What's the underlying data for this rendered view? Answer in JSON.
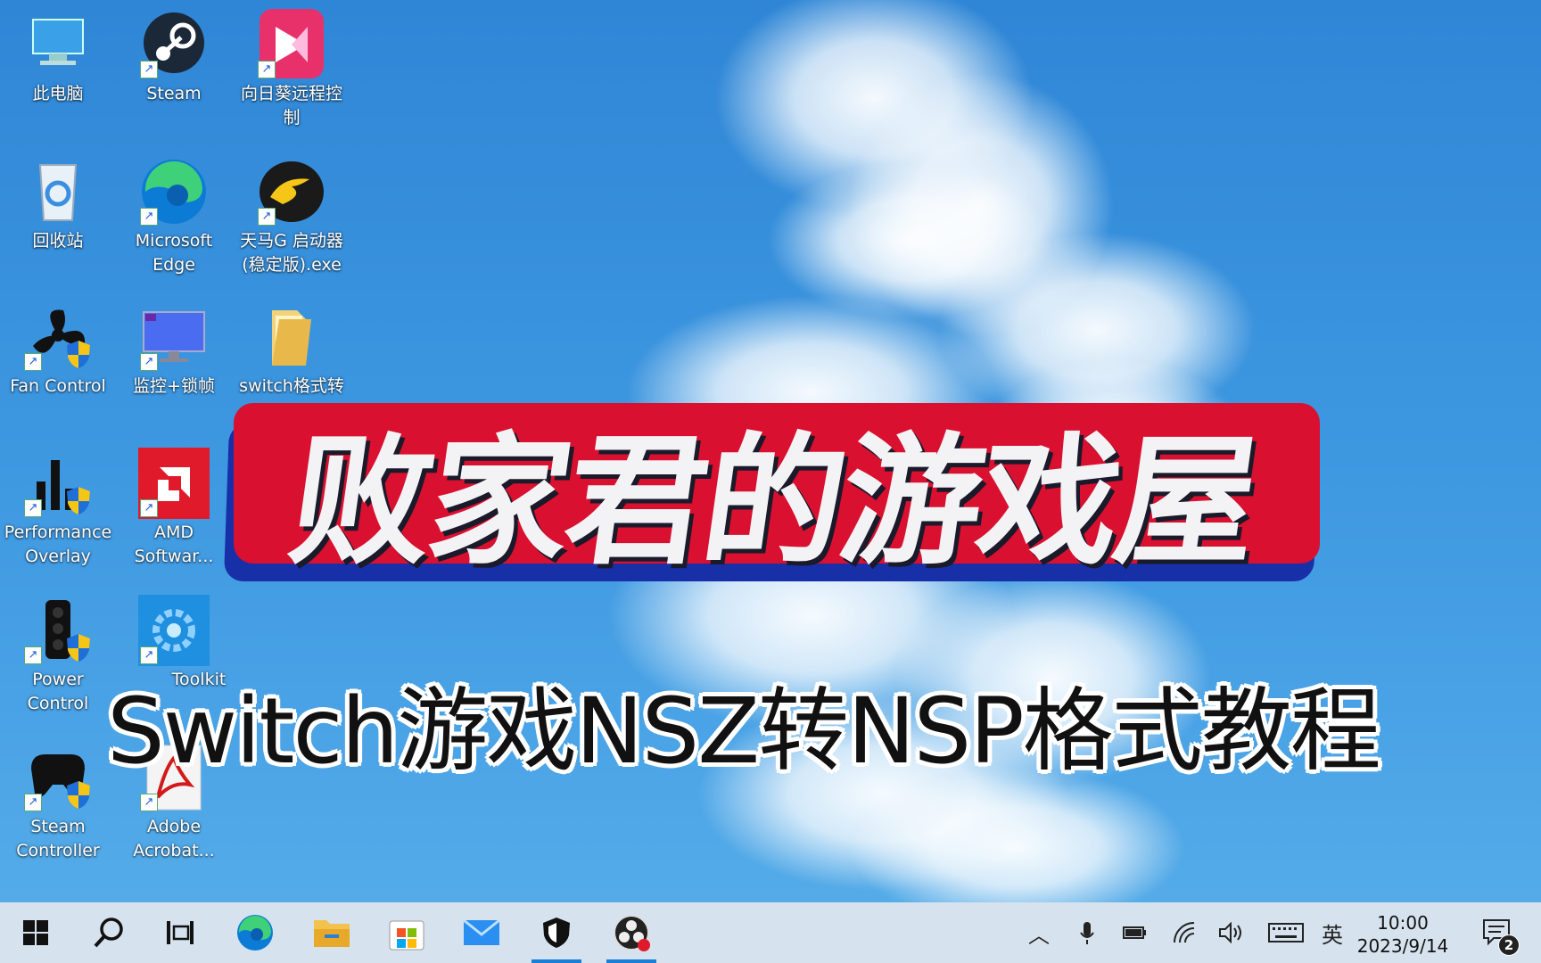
{
  "desktop_icons": [
    {
      "name": "this-pc",
      "label": "此电脑"
    },
    {
      "name": "steam",
      "label": "Steam"
    },
    {
      "name": "sunlogin",
      "label": "向日葵远程控\n制"
    },
    {
      "name": "recycle-bin",
      "label": "回收站"
    },
    {
      "name": "edge",
      "label": "Microsoft\nEdge"
    },
    {
      "name": "tianma",
      "label": "天马G 启动器\n(稳定版).exe"
    },
    {
      "name": "fan-control",
      "label": "Fan Control"
    },
    {
      "name": "monitor-lock",
      "label": "监控+锁帧"
    },
    {
      "name": "switch-folder",
      "label": "switch格式转"
    },
    {
      "name": "performance-overlay",
      "label": "Performance\nOverlay"
    },
    {
      "name": "amd-software",
      "label": "AMD\nSoftwar..."
    },
    {
      "name": "power-control",
      "label": "Power\nControl"
    },
    {
      "name": "toolkit",
      "label": "Toolkit"
    },
    {
      "name": "steam-controller",
      "label": "Steam\nController"
    },
    {
      "name": "adobe-acrobat",
      "label": "Adobe\nAcrobat..."
    }
  ],
  "banner": {
    "title": "败家君的游戏屋",
    "subtitle": "Switch游戏NSZ转NSP格式教程"
  },
  "taskbar": {
    "ime": "英",
    "time": "10:00",
    "date": "2023/9/14",
    "notification_count": "2"
  },
  "colors": {
    "banner_red": "#d9102f",
    "banner_blue": "#1730a8",
    "taskbar": "#d6e3ee",
    "accent": "#1a7fd6"
  }
}
